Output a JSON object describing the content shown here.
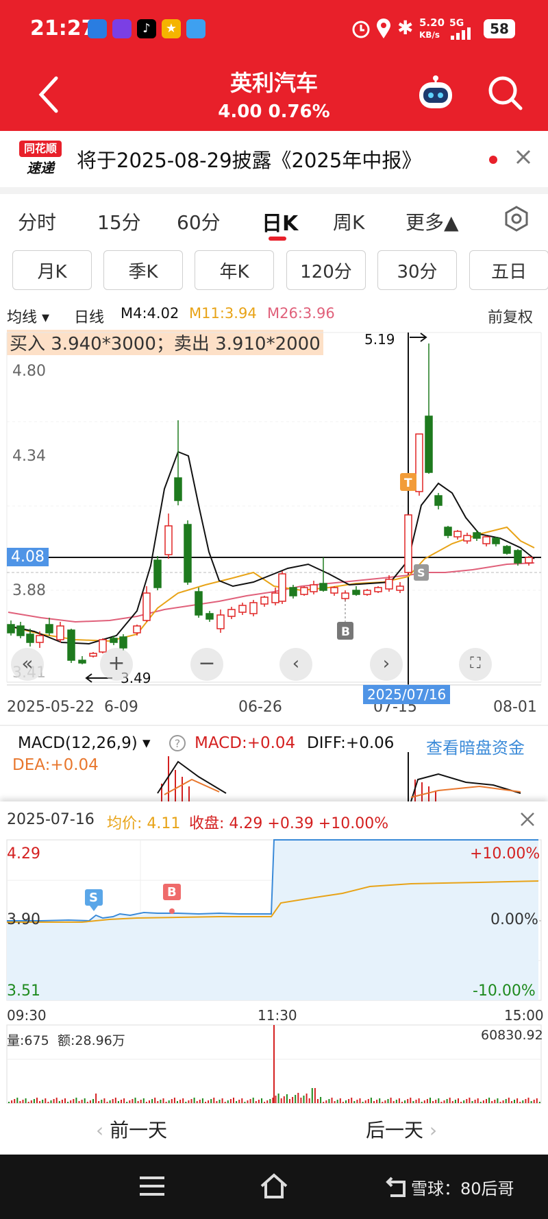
{
  "status_bar": {
    "time": "21:27",
    "net_speed": "5.20",
    "net_unit": "KB/s",
    "network": "5G",
    "battery": "58"
  },
  "header": {
    "title": "英利汽车",
    "price_change": "4.00 0.76%"
  },
  "notice": {
    "logo_line1": "同花顺",
    "logo_line2": "速递",
    "text": "将于2025-08-29披露《2025年中报》"
  },
  "tabs": [
    {
      "label": "分时"
    },
    {
      "label": "15分"
    },
    {
      "label": "60分"
    },
    {
      "label": "日K"
    },
    {
      "label": "周K"
    },
    {
      "label": "更多▲"
    }
  ],
  "sub_tabs": [
    {
      "label": "月K"
    },
    {
      "label": "季K"
    },
    {
      "label": "年K"
    },
    {
      "label": "120分"
    },
    {
      "label": "30分"
    },
    {
      "label": "五日"
    }
  ],
  "kline": {
    "indicator": "均线",
    "period": "日线",
    "m4": "M4:4.02",
    "m11": "M11:3.94",
    "m26": "M26:3.96",
    "adjust": "前复权",
    "trade_banner": "买入 3.940*3000；卖出 3.910*2000",
    "high_label": "5.19",
    "low_label": "3.49",
    "y_labels": [
      "4.80",
      "4.34",
      "3.88",
      "3.41"
    ],
    "current_price": "4.08",
    "dates": [
      "2025-05-22",
      "6-09",
      "06-26",
      "07-15",
      "08-01"
    ],
    "cursor_date": "2025/07/16",
    "markers": {
      "b": "B",
      "s": "S",
      "t": "T"
    },
    "colors": {
      "up": "#e02424",
      "down": "#1e7a1e",
      "m4": "#111111",
      "m11": "#e8a317",
      "m26": "#e0607a"
    }
  },
  "macd": {
    "title": "MACD(12,26,9)",
    "macd": "MACD:+0.04",
    "diff": "DIFF:+0.06",
    "dea": "DEA:+0.04",
    "link": "查看暗盘资金"
  },
  "intraday": {
    "date": "2025-07-16",
    "avg_label": "均价:",
    "avg": "4.11",
    "close_label": "收盘:",
    "close": "4.29 +0.39 +10.00%",
    "y_top": "4.29",
    "y_mid": "3.90",
    "y_bot": "3.51",
    "pct_top": "+10.00%",
    "pct_mid": "0.00%",
    "pct_bot": "-10.00%",
    "t_start": "09:30",
    "t_mid": "11:30",
    "t_end": "15:00",
    "vol": "量:675",
    "amount": "额:28.96万",
    "vol_max": "60830.92",
    "marker_s": "S",
    "marker_b": "B",
    "prev_day": "前一天",
    "next_day": "后一天"
  },
  "watermark": "雪球：80后哥"
}
